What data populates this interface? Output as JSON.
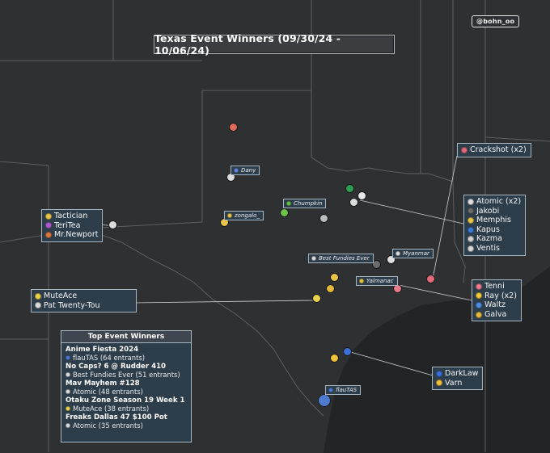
{
  "credit": "@bohn_oo",
  "title": "Texas Event Winners (09/30/24 - 10/06/24)",
  "map": {
    "land_color": "#2f3032",
    "water_color": "#222325",
    "border_color": "#5e5f63",
    "leader_color": "#c9ced2"
  },
  "callouts": {
    "west": {
      "lines": [
        {
          "name": "Tactician",
          "icon": "yellow-character-icon",
          "color": "#e8c548"
        },
        {
          "name": "TeriTea",
          "icon": "purple-character-icon",
          "color": "#b05ad0"
        },
        {
          "name": "Mr.Newport",
          "icon": "red-character-icon",
          "color": "#d9763c"
        }
      ]
    },
    "southwest": {
      "lines": [
        {
          "name": "MuteAce",
          "icon": "yellow-character-icon",
          "color": "#ead24a"
        },
        {
          "name": "Pat Twenty-Tou",
          "icon": "black-white-character-icon",
          "color": "#dcdcdc"
        }
      ]
    },
    "crackshot": {
      "lines": [
        {
          "name": "Crackshot (x2)",
          "icon": "pink-character-icon",
          "color": "#e06a7a"
        }
      ]
    },
    "dallas": {
      "lines": [
        {
          "name": "Atomic (x2)",
          "icon": "black-white-character-icon",
          "color": "#dcdcdc"
        },
        {
          "name": "Jakobi",
          "icon": "dark-character-icon",
          "color": "#6b6b6b"
        },
        {
          "name": "Memphis",
          "icon": "yellow-character-icon",
          "color": "#e8c548"
        },
        {
          "name": "Kapus",
          "icon": "blue-character-icon",
          "color": "#3a78d8"
        },
        {
          "name": "Kazma",
          "icon": "black-white-character-icon",
          "color": "#cfcfcf"
        },
        {
          "name": "Ventis",
          "icon": "black-white-character-icon",
          "color": "#d6d6d6"
        }
      ]
    },
    "houston": {
      "lines": [
        {
          "name": "Tenni",
          "icon": "pink-character-icon",
          "color": "#e87a8a"
        },
        {
          "name": "Ray (x2)",
          "icon": "yellow-character-icon",
          "color": "#f0c83a"
        },
        {
          "name": "Waltz",
          "icon": "blue-character-icon",
          "color": "#4e8ee0"
        },
        {
          "name": "Galva",
          "icon": "yellow-character-icon",
          "color": "#e3b83c"
        }
      ]
    },
    "coast": {
      "lines": [
        {
          "name": "DarkLaw",
          "icon": "blue-character-icon",
          "color": "#3a6fd8"
        },
        {
          "name": "Varn",
          "icon": "yellow-character-icon",
          "color": "#f0c23a"
        }
      ]
    }
  },
  "tags": {
    "dany": {
      "name": "Dany",
      "color": "#6a86e0"
    },
    "zongalo": {
      "name": "zongalo_",
      "color": "#e8c548"
    },
    "chumpkin": {
      "name": "Chumpkin",
      "color": "#6cc24a"
    },
    "best_fundies": {
      "name": "Best Fundies Ever",
      "color": "#dcdcdc"
    },
    "myanmar": {
      "name": "Myanmar",
      "color": "#dcdcdc"
    },
    "yalmanac": {
      "name": "Yalmanac",
      "color": "#e8c548"
    },
    "flautas": {
      "name": "flauTAS",
      "color": "#4e7ad0"
    }
  },
  "top_events": {
    "heading": "Top Event Winners",
    "events": [
      {
        "event": "Anime Fiesta 2024",
        "winner": "flauTAS (64 entrants)",
        "icon_color": "#4e7ad0"
      },
      {
        "event": "No Caps? 6 @ Rudder 410",
        "winner": "Best Fundies Ever (51 entrants)",
        "icon_color": "#dcdcdc"
      },
      {
        "event": "Mav Mayhem #128",
        "winner": "Atomic (48 entrants)",
        "icon_color": "#dcdcdc"
      },
      {
        "event": "Otaku Zone Season 19 Week 1",
        "winner": "MuteAce (38 entrants)",
        "icon_color": "#ead24a"
      },
      {
        "event": "Freaks Dallas 47 $100 Pot",
        "winner": "Atomic (35 entrants)",
        "icon_color": "#dcdcdc"
      }
    ]
  }
}
